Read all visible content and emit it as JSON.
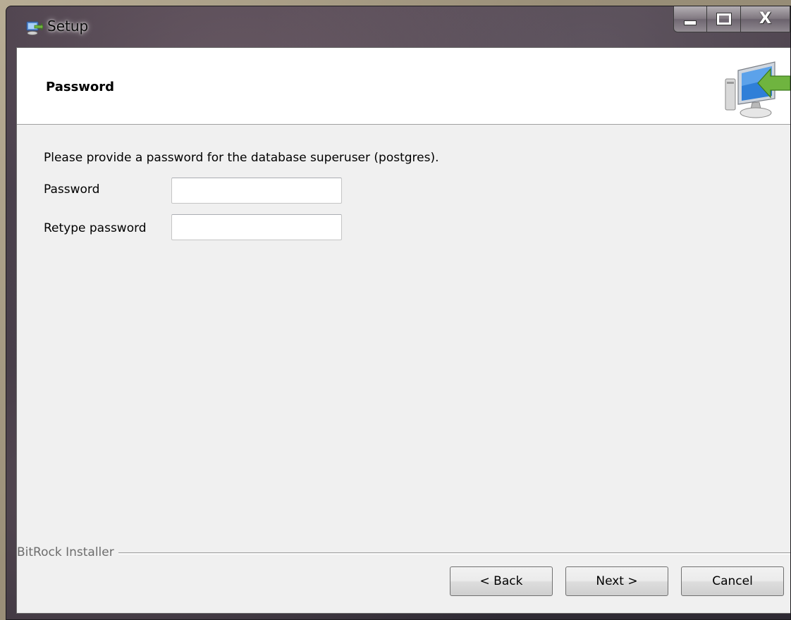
{
  "window": {
    "title": "Setup",
    "icons": {
      "app": "setup-app-icon",
      "minimize": "minimize-icon",
      "maximize": "maximize-icon",
      "close": "close-icon",
      "header": "computer-install-icon"
    },
    "close_glyph": "X"
  },
  "header": {
    "title": "Password"
  },
  "content": {
    "instruction": "Please provide a password for the database superuser (postgres).",
    "password_label": "Password",
    "password_value": "",
    "retype_label": "Retype password",
    "retype_value": ""
  },
  "footer": {
    "brand": "BitRock Installer",
    "back_label": "< Back",
    "next_label": "Next >",
    "cancel_label": "Cancel"
  },
  "colors": {
    "client_bg": "#f0f0f0",
    "header_bg": "#ffffff",
    "accent_green": "#6fb43f",
    "accent_blue": "#2f7fd8"
  }
}
